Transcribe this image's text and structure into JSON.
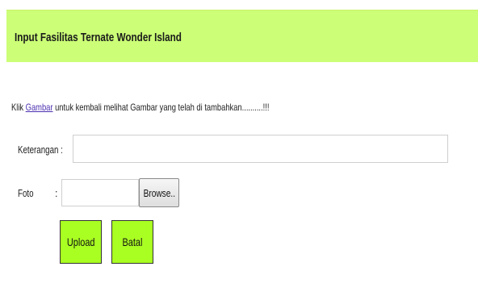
{
  "header": {
    "title": "Input Fasilitas Ternate Wonder Island"
  },
  "instruction": {
    "prefix": "Klik ",
    "link": "Gambar",
    "suffix": " untuk kembali melihat Gambar yang telah di tambahkan..........!!!"
  },
  "form": {
    "keterangan_label": "Keterangan :",
    "keterangan_value": "",
    "foto_label": "Foto",
    "foto_colon": ":",
    "foto_value": "",
    "browse_label": "Browse..",
    "upload_label": "Upload",
    "batal_label": "Batal"
  },
  "colors": {
    "header_bg": "#ccff77",
    "button_bg": "#aaff22",
    "link": "#4b2fb0"
  }
}
